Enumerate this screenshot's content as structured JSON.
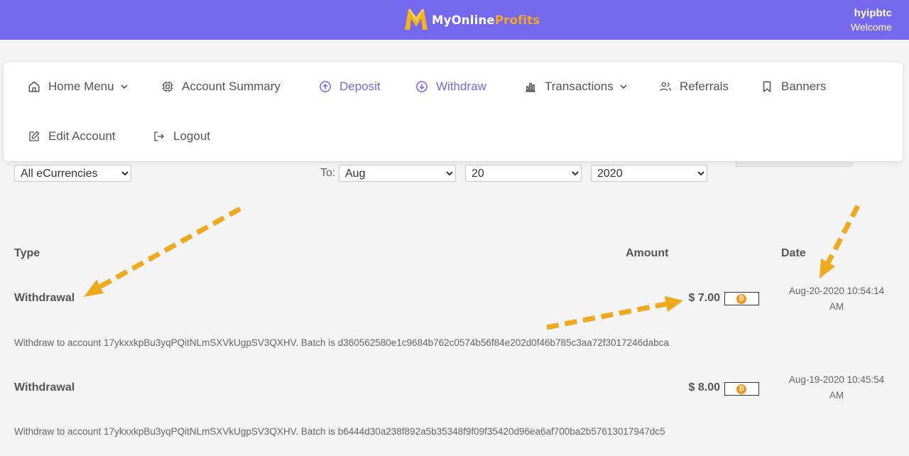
{
  "header": {
    "logo_part1": "MyOnline",
    "logo_part2": "Profits",
    "username": "hyipbtc",
    "welcome": "Welcome",
    "background_color": "#7468ec",
    "brand_accent": "#f5a623"
  },
  "nav": {
    "home_menu": "Home Menu",
    "account_summary": "Account Summary",
    "deposit": "Deposit",
    "withdraw": "Withdraw",
    "transactions": "Transactions",
    "referrals": "Referrals",
    "banners": "Banners",
    "edit_account": "Edit Account",
    "logout": "Logout",
    "icons": [
      "home-icon",
      "chip-icon",
      "arrow-up-circle-icon",
      "arrow-down-circle-icon",
      "bar-chart-icon",
      "users-icon",
      "bookmark-icon",
      "edit-icon",
      "logout-icon"
    ]
  },
  "filters": {
    "ecurrency": "All eCurrencies",
    "to_label": "To:",
    "to_month": "Aug",
    "to_day": "20",
    "to_year": "2020"
  },
  "table": {
    "headers": {
      "type": "Type",
      "amount": "Amount",
      "date": "Date"
    },
    "rows": [
      {
        "type": "Withdrawal",
        "amount": "$ 7.00",
        "currency_icon": "bitcoin-icon",
        "date_line1": "Aug-20-2020 10:54:14",
        "date_line2": "AM",
        "description": "Withdraw to account 17ykxxkpBu3yqPQitNLmSXVkUgpSV3QXHV. Batch is d360562580e1c9684b762c0574b56f84e202d0f46b785c3aa72f3017246dabca"
      },
      {
        "type": "Withdrawal",
        "amount": "$ 8.00",
        "currency_icon": "bitcoin-icon",
        "date_line1": "Aug-19-2020 10:45:54",
        "date_line2": "AM",
        "description": "Withdraw to account 17ykxxkpBu3yqPQitNLmSXVkUgpSV3QXHV. Batch is b6444d30a238f892a5b35348f9f09f35420d96ea6af700ba2b57613017947dc5"
      }
    ]
  },
  "coin_glyph": "₿",
  "annotation_color": "#f0a81c"
}
